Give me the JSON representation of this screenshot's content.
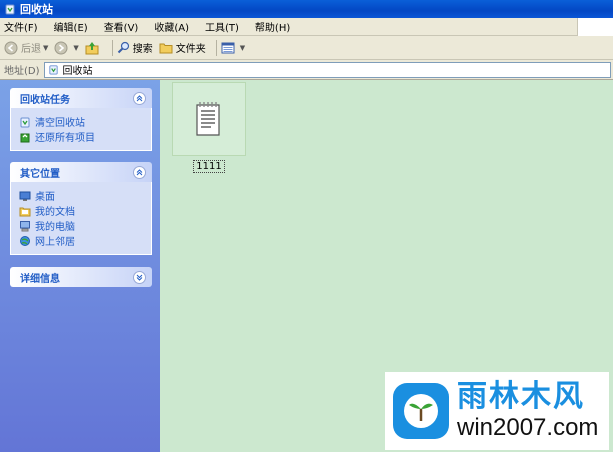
{
  "window": {
    "title": "回收站"
  },
  "menu": [
    "文件(F)",
    "编辑(E)",
    "查看(V)",
    "收藏(A)",
    "工具(T)",
    "帮助(H)"
  ],
  "toolbar": {
    "back": "后退",
    "search": "搜索",
    "folders": "文件夹"
  },
  "address": {
    "label": "地址(D)",
    "value": "回收站"
  },
  "panels": {
    "tasks": {
      "title": "回收站任务",
      "items": [
        "清空回收站",
        "还原所有项目"
      ]
    },
    "places": {
      "title": "其它位置",
      "items": [
        "桌面",
        "我的文档",
        "我的电脑",
        "网上邻居"
      ]
    },
    "details": {
      "title": "详细信息"
    }
  },
  "files": [
    {
      "name": "1111",
      "icon": "text-document-icon"
    }
  ],
  "watermark": {
    "title": "雨林木风",
    "url": "win2007.com"
  },
  "colors": {
    "titlebar": "#0a5fd8",
    "left_pane": "#7ba2e7",
    "content_bg": "#cce8cf",
    "link": "#215dc6"
  }
}
